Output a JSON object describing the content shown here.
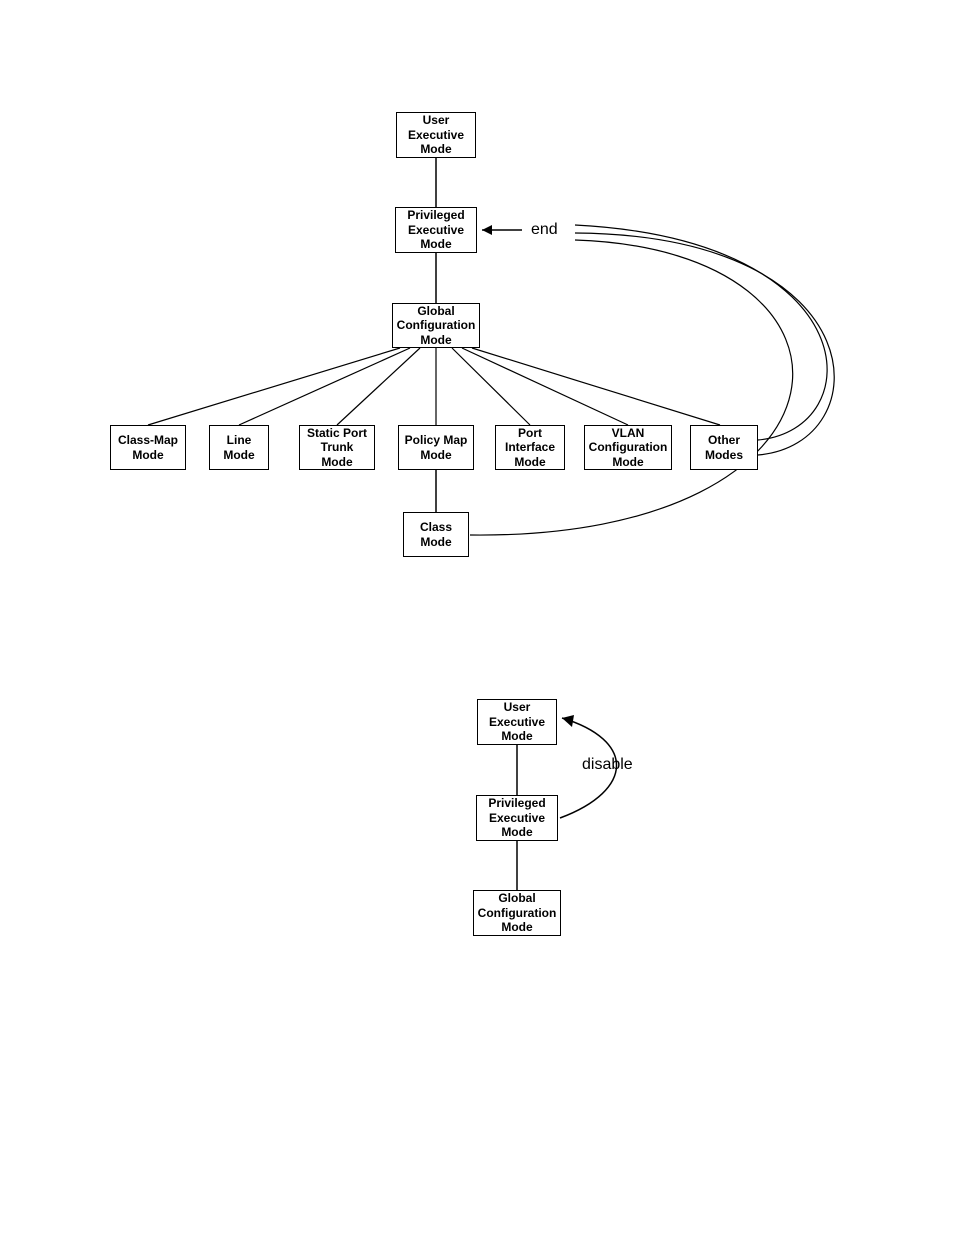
{
  "diagram1": {
    "user_exec": "User\nExecutive\nMode",
    "priv_exec": "Privileged\nExecutive\nMode",
    "global_conf": "Global\nConfiguration\nMode",
    "end_label": "end",
    "children": {
      "class_map": "Class-Map\nMode",
      "line": "Line\nMode",
      "static_port_trunk": "Static Port\nTrunk\nMode",
      "policy_map": "Policy Map\nMode",
      "port_interface": "Port\nInterface\nMode",
      "vlan_config": "VLAN\nConfiguration\nMode",
      "other_modes": "Other\nModes"
    },
    "class_mode": "Class\nMode"
  },
  "diagram2": {
    "user_exec": "User\nExecutive\nMode",
    "priv_exec": "Privileged\nExecutive\nMode",
    "global_conf": "Global\nConfiguration\nMode",
    "disable_label": "disable"
  }
}
